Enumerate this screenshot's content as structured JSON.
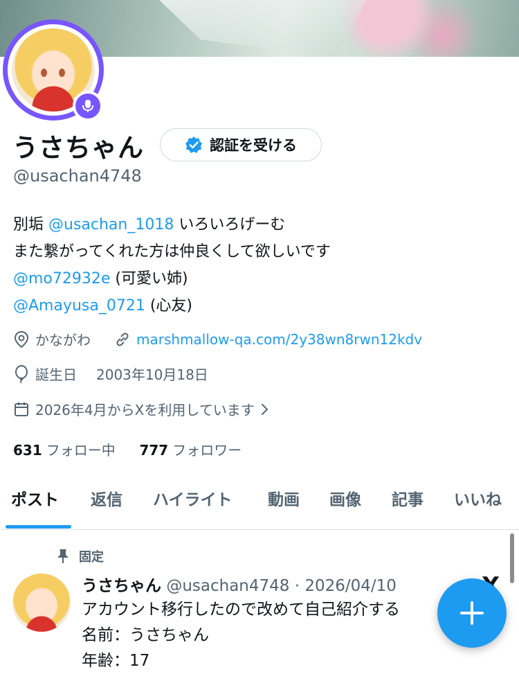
{
  "profile": {
    "name": "うさちゃん",
    "verify_label": "認証を受ける",
    "handle": "@usachan4748",
    "bio": {
      "line1_link": "@usachan_1018",
      "line1_text": " いろいろげーむ",
      "line2": "また繋がってくれた方は仲良くして欲しいです",
      "line3_link": "@mo72932e",
      "line3_text": " (可愛い姉)",
      "line4_link": "@Amayusa_0721",
      "line4_text": " (心友)"
    },
    "location": "かながわ",
    "website": "marshmallow-qa.com/2y38wn8rwn12kdv",
    "birthday_label": "誕生日",
    "birthday": "2003年10月18日",
    "joined": "2026年4月からXを利用しています",
    "following_count": "631",
    "following_label": "フォロー中",
    "followers_count": "777",
    "followers_label": "フォロワー"
  },
  "tabs": [
    "ポスト",
    "返信",
    "ハイライト",
    "動画",
    "画像",
    "記事",
    "いいね"
  ],
  "pinned_post": {
    "pinned_label": "固定",
    "author": "うさちゃん",
    "handle_date": "@usachan4748 · 2026/04/10",
    "lines": [
      "アカウント移行したので改めて自己紹介する",
      "名前：うさちゃん",
      "年齢：17"
    ],
    "x_glyph": "X"
  },
  "colors": {
    "accent": "#1d9bf0",
    "ring": "#7856ff",
    "muted": "#536471"
  },
  "icons": [
    "microphone-icon",
    "verified-check-icon",
    "location-pin-icon",
    "link-icon",
    "balloon-icon",
    "calendar-icon",
    "chevron-right-icon",
    "pin-icon",
    "plus-icon"
  ]
}
